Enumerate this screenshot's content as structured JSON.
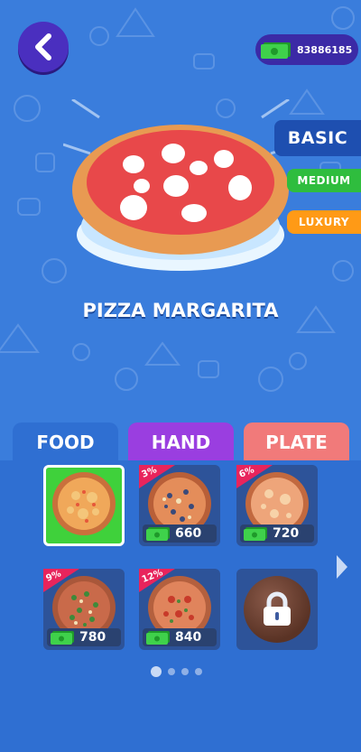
{
  "header": {
    "back_icon": "chevron-left-icon",
    "currency_icon": "cash-icon",
    "currency_amount": "83886185"
  },
  "tiers": [
    {
      "label": "BASIC",
      "color": "#1e4fb0"
    },
    {
      "label": "MEDIUM",
      "color": "#2fbd3e"
    },
    {
      "label": "LUXURY",
      "color": "#ff9a16"
    }
  ],
  "pizza_name": "PIZZA MARGARITA",
  "tabs": [
    {
      "label": "FOOD",
      "color": "#2f6fd2"
    },
    {
      "label": "HAND",
      "color": "#9a3ee0"
    },
    {
      "label": "PLATE",
      "color": "#f17a7a"
    }
  ],
  "items": [
    {
      "name": "item-1",
      "selected": true,
      "discount": "",
      "price": ""
    },
    {
      "name": "item-2",
      "selected": false,
      "discount": "3%",
      "price": "660"
    },
    {
      "name": "item-3",
      "selected": false,
      "discount": "6%",
      "price": "720"
    },
    {
      "name": "item-4",
      "selected": false,
      "discount": "9%",
      "price": "780"
    },
    {
      "name": "item-5",
      "selected": false,
      "discount": "12%",
      "price": "840"
    },
    {
      "name": "item-6",
      "locked": true,
      "icon": "lock-icon"
    }
  ],
  "pagination": {
    "pages": 4,
    "active": 1
  },
  "colors": {
    "background": "#3a7ddc",
    "panel": "#2f6fd2",
    "selected": "#3fd13b",
    "badge": "#e8245c"
  }
}
